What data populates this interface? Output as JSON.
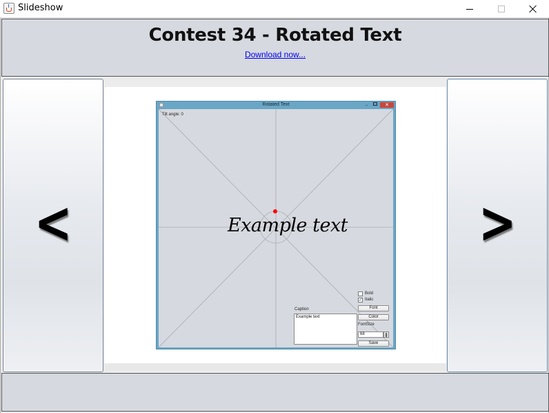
{
  "window": {
    "title": "Slideshow",
    "controls": {
      "minimize": "minimize-icon",
      "maximize": "maximize-icon",
      "close": "close-icon"
    }
  },
  "header": {
    "title": "Contest 34 - Rotated Text",
    "download_link": "Download now..."
  },
  "navigation": {
    "prev_label": "<",
    "next_label": ">"
  },
  "slide": {
    "window_title": "Rotated Text",
    "tilt_label": "Tilt angle: 0",
    "sample_text": "Example text",
    "controls": {
      "bold_label": "Bold",
      "bold_checked": false,
      "italic_label": "Italic",
      "italic_checked": true,
      "font_button": "Font",
      "color_button": "Color",
      "fontsize_label": "FontSize",
      "fontsize_value": "68",
      "save_button": "Save",
      "caption_label": "Caption",
      "caption_value": "Example text"
    }
  },
  "colors": {
    "panel_background": "#d6d9df",
    "inner_window_frame": "#6aa6c6",
    "center_dot": "#ff0000",
    "link": "#0000ee"
  }
}
